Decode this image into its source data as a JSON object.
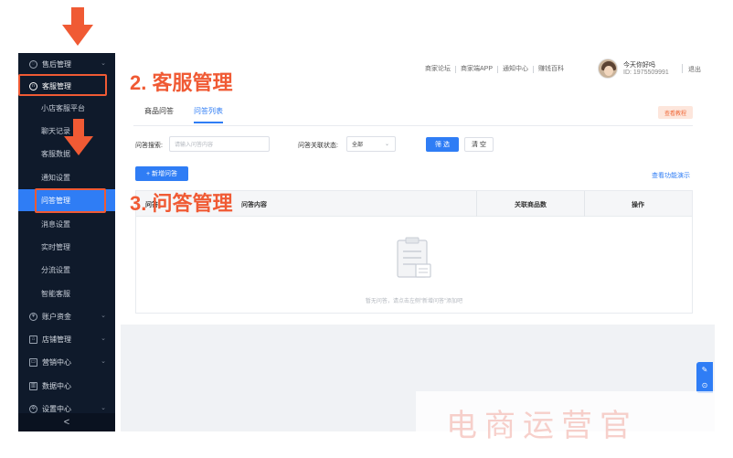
{
  "sidebar": {
    "items": [
      {
        "label": "售后管理",
        "icon": "shield-icon",
        "chev": "⌄"
      },
      {
        "label": "客服管理",
        "icon": "headset-icon"
      },
      {
        "label": "小店客服平台"
      },
      {
        "label": "聊天记录"
      },
      {
        "label": "客服数据"
      },
      {
        "label": "通知设置"
      },
      {
        "label": "问答管理"
      },
      {
        "label": "消息设置"
      },
      {
        "label": "实时管理"
      },
      {
        "label": "分流设置"
      },
      {
        "label": "智能客服"
      },
      {
        "label": "账户资金",
        "icon": "coin-icon",
        "chev": "⌄"
      },
      {
        "label": "店铺管理",
        "icon": "store-icon",
        "chev": "⌄"
      },
      {
        "label": "营销中心",
        "icon": "monitor-icon",
        "chev": "⌄"
      },
      {
        "label": "数据中心",
        "icon": "chart-icon"
      },
      {
        "label": "设置中心",
        "icon": "gear-icon",
        "chev": "⌄"
      }
    ],
    "collapse_symbol": "<"
  },
  "header": {
    "links": [
      "商家论坛",
      "商家端APP",
      "通知中心",
      "赚钱百科"
    ],
    "user_name": "今天你好吗",
    "user_id": "ID: 1975509991",
    "logout": "退出"
  },
  "annotations": {
    "step2": "2. 客服管理",
    "step3": "3. 问答管理",
    "accent_color": "#f05a34"
  },
  "main": {
    "tabs": [
      {
        "label": "商品问答",
        "active": false
      },
      {
        "label": "问答列表",
        "active": true
      }
    ],
    "tutorial_button": "查看教程",
    "filter": {
      "search_label": "问答搜索:",
      "search_placeholder": "请输入问答内容",
      "status_label": "问答关联状态:",
      "status_value": "全部",
      "filter_button": "筛 选",
      "reset_button": "清 空"
    },
    "add_button": "+ 新增问答",
    "demo_link": "查看功能演示",
    "table": {
      "columns": [
        "问答",
        "问答内容",
        "关联商品数",
        "操作"
      ],
      "empty_text": "暂无问答，请点击左侧\"新增问答\"添加吧"
    }
  },
  "watermark": "电商运营官",
  "brand_color": "#2f7df5"
}
